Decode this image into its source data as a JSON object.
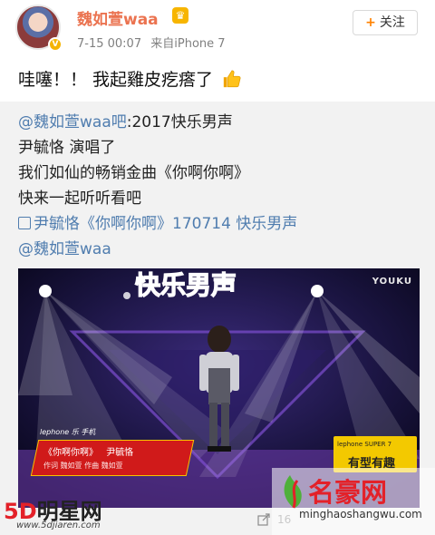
{
  "post": {
    "username": "魏如萱waa",
    "crown_icon": "crown-icon",
    "verified_badge": "V",
    "time": "7-15 00:07",
    "source": "来自iPhone 7",
    "follow_label": "关注",
    "follow_plus": "+",
    "status_text": "哇噻！！ 我起雞皮疙瘩了",
    "status_emoji": "thumbs-up-icon"
  },
  "repost": {
    "author_mention": "@魏如萱waa吧",
    "line1_rest": ":2017快乐男声",
    "line2": "尹毓恪 演唱了",
    "line3": "我们如仙的畅销金曲《你啊你啊》",
    "line4": "快来一起听听看吧",
    "video_link": "尹毓恪《你啊你啊》170714 快乐男声",
    "mention": "@魏如萱waa"
  },
  "video": {
    "show_logo": "快乐男声",
    "platform": "YOUKU",
    "caption_brand": "lephone 乐 手机",
    "caption_song": "《你啊你啊》",
    "caption_singer": "尹毓恪",
    "caption_credits": "作词 魏如萱    作曲 魏如萱",
    "sponsor_top": "lephone SUPER 7",
    "sponsor_name": "有型有趣"
  },
  "footer": {
    "share_icon": "repost-icon",
    "count_partial": "16"
  },
  "watermarks": {
    "left_main_a": "5D",
    "left_main_b": "明星网",
    "left_sub": "www.5djiaren.com",
    "right_main": "名豪网",
    "right_sub": "minghaoshangwu.com"
  },
  "colors": {
    "username": "#eb7350",
    "link": "#507daf",
    "repost_bg": "#f2f2f2",
    "follow_plus": "#ff8200",
    "watermark_red": "#e32129"
  }
}
